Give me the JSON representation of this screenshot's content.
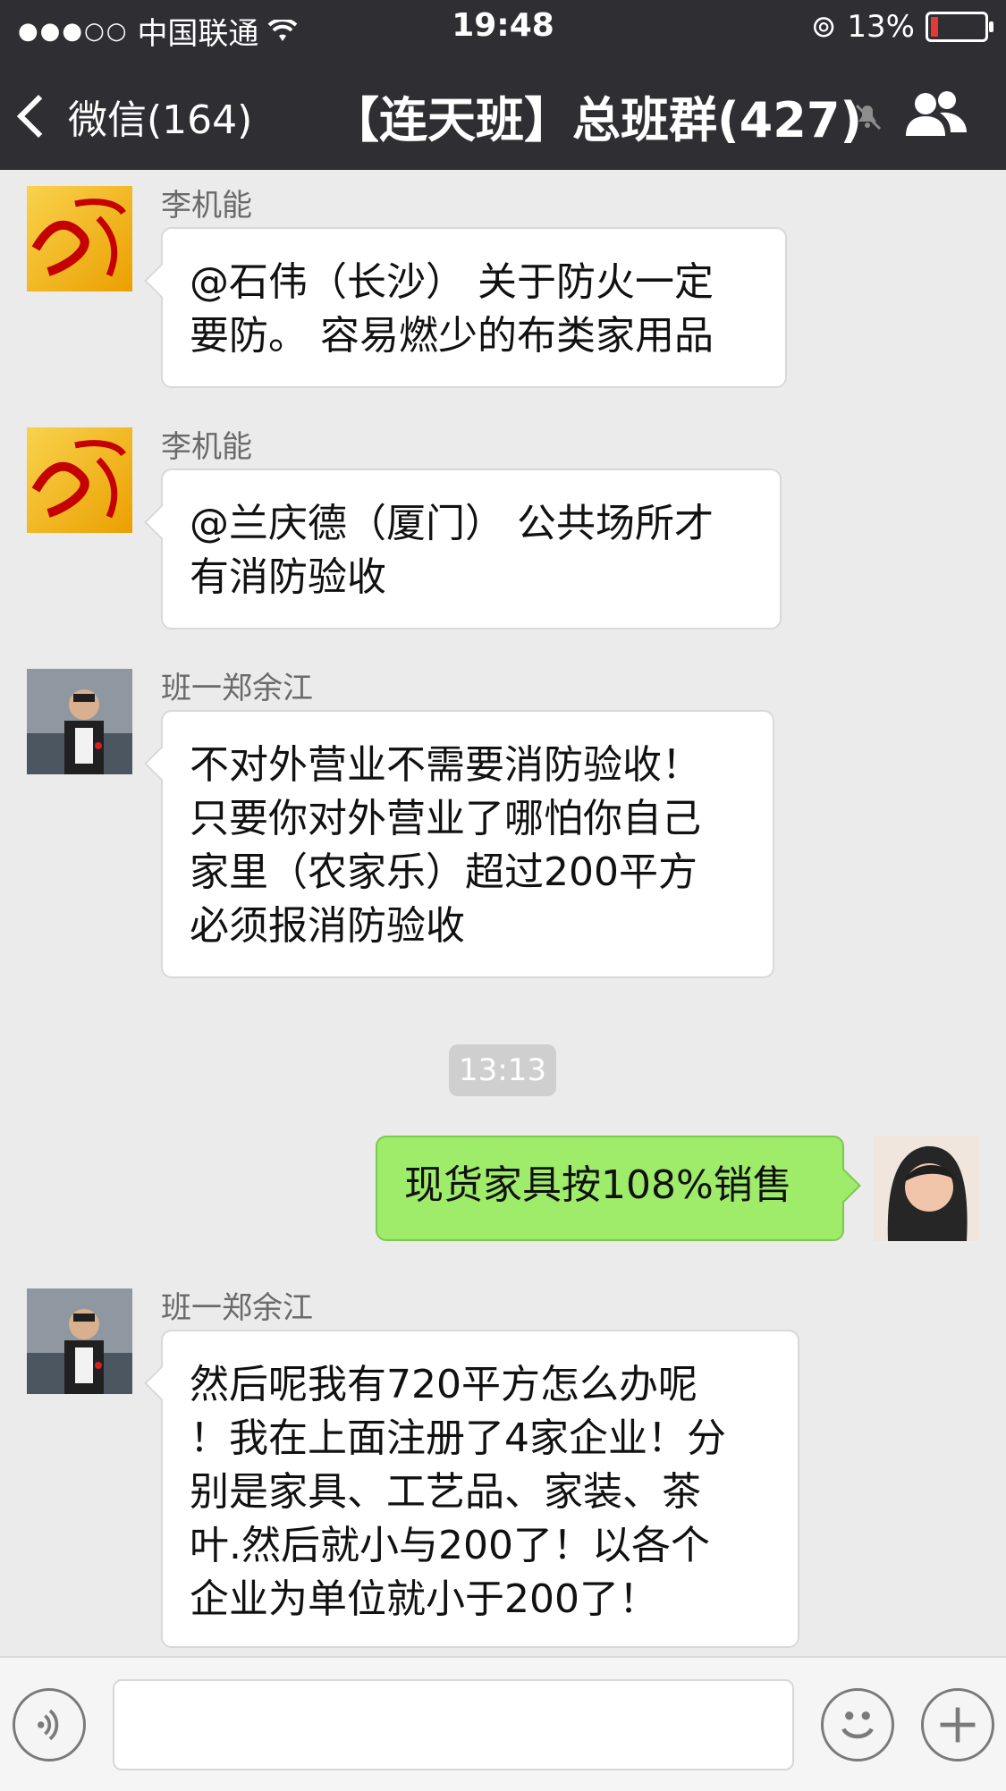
{
  "status_bar": {
    "carrier": "中国联通",
    "time": "19:48",
    "battery": "13%"
  },
  "nav": {
    "back_label": "微信(164)",
    "title": "【连天班】总班群(427)"
  },
  "messages": [
    {
      "side": "left",
      "sender": "李机能",
      "avatar": "red-calligraphy-avatar",
      "lines": [
        "@石伟（长沙） 关于防火一定",
        "要防。 容易燃少的布类家用品"
      ]
    },
    {
      "side": "left",
      "sender": "李机能",
      "avatar": "red-calligraphy-avatar",
      "lines": [
        "@兰庆德（厦门） 公共场所才",
        "有消防验收"
      ]
    },
    {
      "side": "left",
      "sender": "班一郑余江",
      "avatar": "man-portrait-avatar",
      "lines": [
        "不对外营业不需要消防验收！",
        "只要你对外营业了哪怕你自己",
        "家里（农家乐）超过200平方",
        "必须报消防验收"
      ]
    },
    {
      "side": "right",
      "sender": "",
      "avatar": "woman-portrait-avatar",
      "lines": [
        "现货家具按108%销售"
      ]
    },
    {
      "side": "left",
      "sender": "班一郑余江",
      "avatar": "man-portrait-avatar",
      "lines": [
        "然后呢我有720平方怎么办呢",
        "！我在上面注册了4家企业！分",
        "别是家具、工艺品、家装、茶",
        "叶.然后就小与200了！以各个",
        "企业为单位就小于200了！"
      ]
    }
  ],
  "timestamp": "13:13",
  "input": {
    "placeholder": ""
  },
  "colors": {
    "header": "#2e2e33",
    "chat_bg": "#ebebeb",
    "my_bubble": "#9feb6a"
  }
}
